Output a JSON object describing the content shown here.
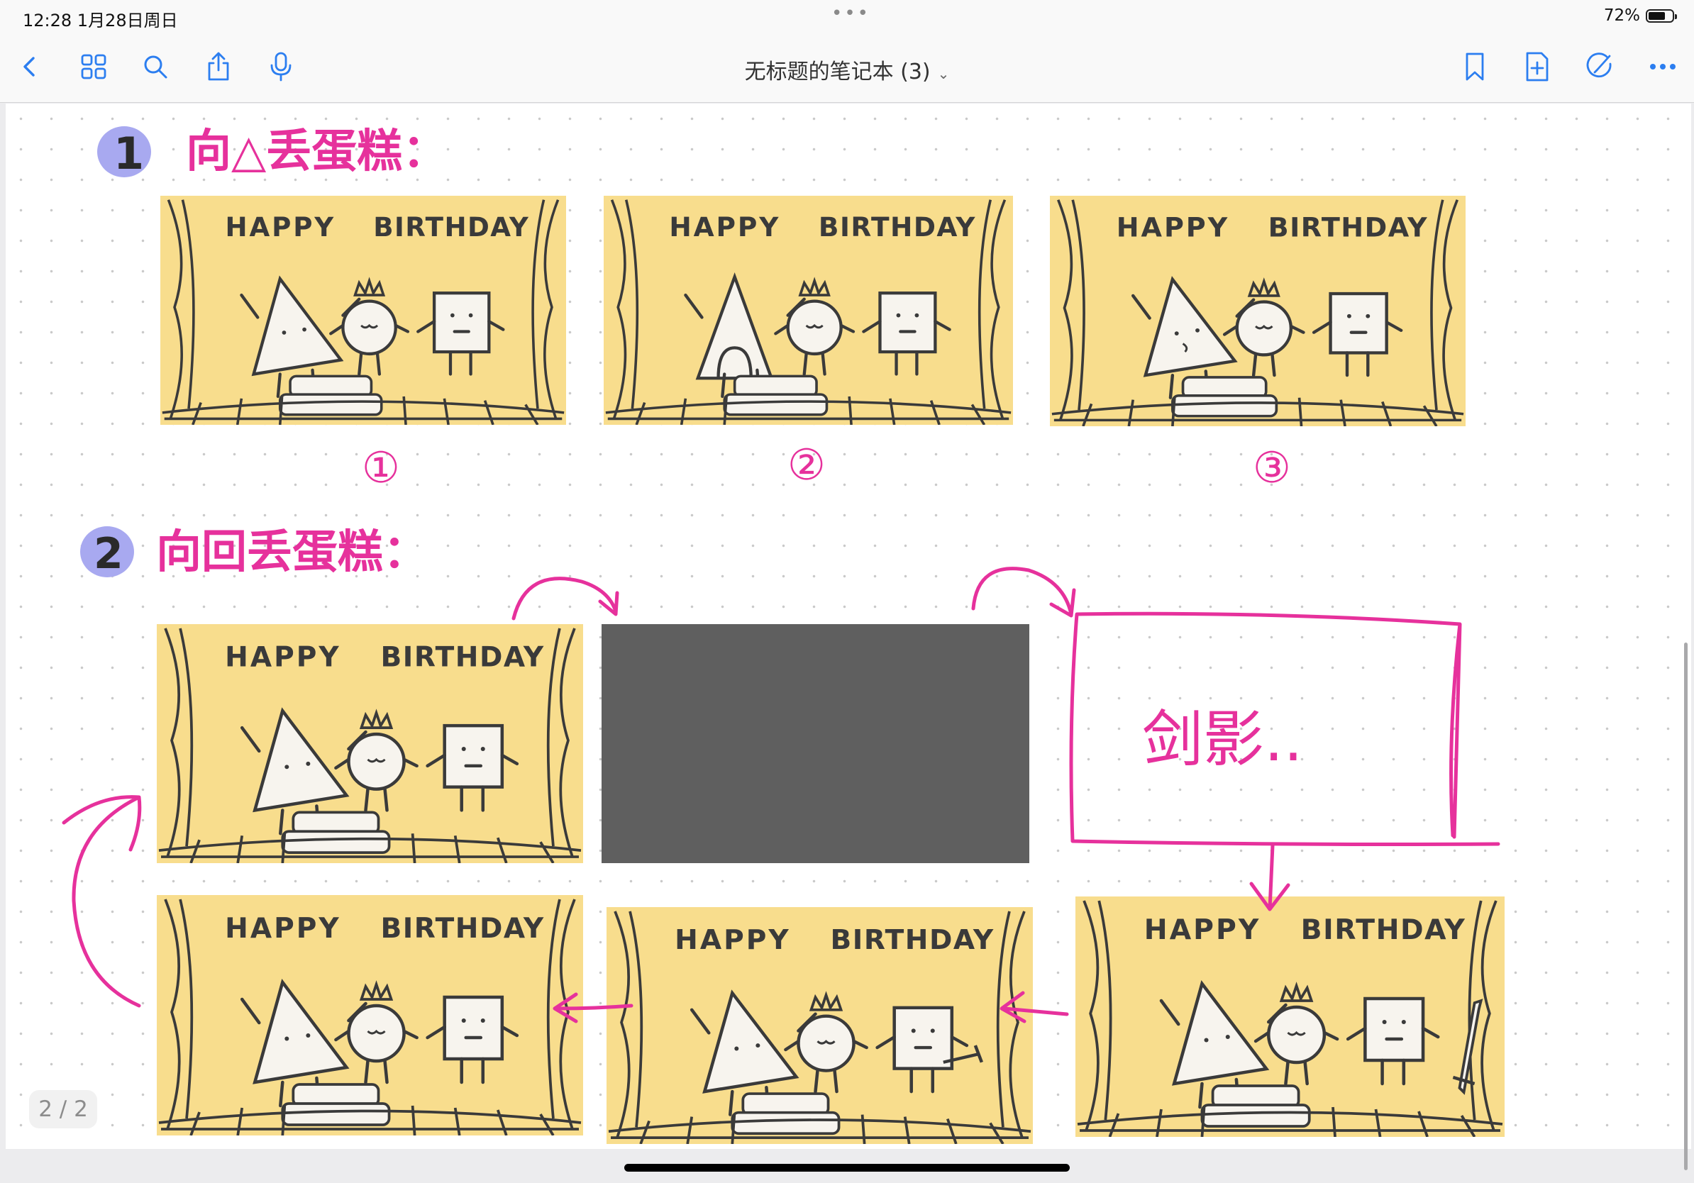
{
  "status_bar": {
    "time_date": "12:28   1月28日周日",
    "dots": "•••",
    "battery_text": "72%",
    "battery_level": 0.72
  },
  "toolbar": {
    "title": "无标题的笔记本 (3)",
    "left_icons": [
      "back-icon",
      "grid-icon",
      "search-icon",
      "share-icon",
      "microphone-icon"
    ],
    "right_icons": [
      "bookmark-icon",
      "add-page-icon",
      "pen-edit-icon",
      "more-icon"
    ]
  },
  "notes": {
    "section1": {
      "number": "1",
      "heading": "向△丢蛋糕："
    },
    "section2": {
      "number": "2",
      "heading": "向回丢蛋糕："
    },
    "circled_labels": [
      "①",
      "②",
      "③"
    ],
    "box_text": "剑影.."
  },
  "panel": {
    "word1": "HAPPY",
    "word2": "BIRTHDAY",
    "candles": "iii"
  },
  "page_indicator": "2 / 2",
  "colors": {
    "ink": "#e6319c",
    "highlight": "#a8a9f0",
    "panel_bg": "#f8dd8d",
    "dark_panel": "#5f5f5f"
  }
}
